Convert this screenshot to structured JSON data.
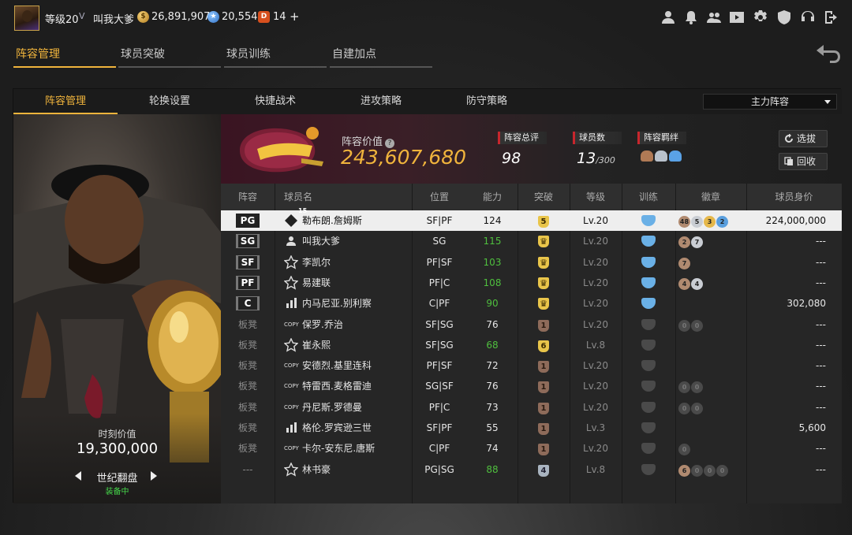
{
  "topbar": {
    "level": "等级20",
    "rank_badge": "V",
    "username": "叫我大爹",
    "gold": "26,891,907",
    "stars": "20,554",
    "tickets": "14",
    "plus": "+"
  },
  "main_tabs": [
    "阵容管理",
    "球员突破",
    "球员训练",
    "自建加点"
  ],
  "sub_tabs": [
    "阵容管理",
    "轮换设置",
    "快捷战术",
    "进攻策略",
    "防守策略"
  ],
  "lineup_select": "主力阵容",
  "card": {
    "value_label": "时刻价值",
    "value": "19,300,000",
    "name": "世纪翻盘",
    "status": "装备中"
  },
  "team": {
    "value_label": "阵容价值",
    "value": "243,607,680",
    "rating_label": "阵容总评",
    "rating": "98",
    "count_label": "球员数",
    "count": "13",
    "count_max": "/300",
    "bond_label": "阵容羁绊",
    "btn_select": "选拔",
    "btn_recycle": "回收"
  },
  "table": {
    "headers": [
      "阵容",
      "球员名",
      "位置",
      "能力",
      "突破",
      "等级",
      "训练",
      "徽章",
      "球员身价"
    ],
    "rows": [
      {
        "slot": "PG",
        "starter": true,
        "type": "15",
        "name": "勒布朗.詹姆斯",
        "pos": "SF|PF",
        "ability": "124",
        "ab_color": "white",
        "break": "5",
        "break_style": "gold",
        "level": "Lv.20",
        "train": "blue",
        "medals": [
          {
            "t": "48",
            "c": "bronze"
          },
          {
            "t": "5",
            "c": "silver"
          },
          {
            "t": "3",
            "c": "gold"
          },
          {
            "t": "2",
            "c": "blue"
          }
        ],
        "value": "224,000,000"
      },
      {
        "slot": "SG",
        "starter": true,
        "type": "person",
        "name": "叫我大爹",
        "pos": "SG",
        "ability": "115",
        "ab_color": "green",
        "break": "crown",
        "break_style": "gold",
        "level": "Lv.20",
        "train": "blue",
        "medals": [
          {
            "t": "2",
            "c": "bronze"
          },
          {
            "t": "7",
            "c": "silver"
          }
        ],
        "value": "---"
      },
      {
        "slot": "SF",
        "starter": true,
        "type": "star",
        "name": "李凯尔",
        "pos": "PF|SF",
        "ability": "103",
        "ab_color": "green",
        "break": "crown",
        "break_style": "gold",
        "level": "Lv.20",
        "train": "blue",
        "medals": [
          {
            "t": "7",
            "c": "bronze"
          }
        ],
        "value": "---"
      },
      {
        "slot": "PF",
        "starter": true,
        "type": "star",
        "name": "易建联",
        "pos": "PF|C",
        "ability": "108",
        "ab_color": "green",
        "break": "crown",
        "break_style": "gold",
        "level": "Lv.20",
        "train": "blue",
        "medals": [
          {
            "t": "4",
            "c": "bronze"
          },
          {
            "t": "4",
            "c": "silver"
          }
        ],
        "value": "---"
      },
      {
        "slot": "C",
        "starter": true,
        "type": "bars",
        "name": "内马尼亚.别利察",
        "pos": "C|PF",
        "ability": "90",
        "ab_color": "green",
        "break": "crown",
        "break_style": "gold",
        "level": "Lv.20",
        "train": "blue",
        "medals": [],
        "value": "302,080"
      },
      {
        "slot": "板凳",
        "starter": false,
        "type": "copy",
        "name": "保罗.乔治",
        "pos": "SF|SG",
        "ability": "76",
        "ab_color": "white",
        "break": "1",
        "break_style": "brown",
        "level": "Lv.20",
        "train": "grey",
        "medals": [
          {
            "t": "0",
            "c": "dark"
          },
          {
            "t": "0",
            "c": "dark"
          }
        ],
        "value": "---"
      },
      {
        "slot": "板凳",
        "starter": false,
        "type": "star",
        "name": "崔永熙",
        "pos": "SF|SG",
        "ability": "68",
        "ab_color": "green",
        "break": "6",
        "break_style": "gold",
        "level": "Lv.8",
        "train": "grey",
        "medals": [],
        "value": "---"
      },
      {
        "slot": "板凳",
        "starter": false,
        "type": "copy",
        "name": "安德烈.基里连科",
        "pos": "PF|SF",
        "ability": "72",
        "ab_color": "white",
        "break": "1",
        "break_style": "brown",
        "level": "Lv.20",
        "train": "grey",
        "medals": [],
        "value": "---"
      },
      {
        "slot": "板凳",
        "starter": false,
        "type": "copy",
        "name": "特雷西.麦格雷迪",
        "pos": "SG|SF",
        "ability": "76",
        "ab_color": "white",
        "break": "1",
        "break_style": "brown",
        "level": "Lv.20",
        "train": "grey",
        "medals": [
          {
            "t": "0",
            "c": "dark"
          },
          {
            "t": "0",
            "c": "dark"
          }
        ],
        "value": "---"
      },
      {
        "slot": "板凳",
        "starter": false,
        "type": "copy",
        "name": "丹尼斯.罗德曼",
        "pos": "PF|C",
        "ability": "73",
        "ab_color": "white",
        "break": "1",
        "break_style": "brown",
        "level": "Lv.20",
        "train": "grey",
        "medals": [
          {
            "t": "0",
            "c": "dark"
          },
          {
            "t": "0",
            "c": "dark"
          }
        ],
        "value": "---"
      },
      {
        "slot": "板凳",
        "starter": false,
        "type": "bars",
        "name": "格伦.罗宾逊三世",
        "pos": "SF|PF",
        "ability": "55",
        "ab_color": "white",
        "break": "1",
        "break_style": "brown",
        "level": "Lv.3",
        "train": "grey",
        "medals": [],
        "value": "5,600"
      },
      {
        "slot": "板凳",
        "starter": false,
        "type": "copy",
        "name": "卡尔-安东尼.唐斯",
        "pos": "C|PF",
        "ability": "74",
        "ab_color": "white",
        "break": "1",
        "break_style": "brown",
        "level": "Lv.20",
        "train": "grey",
        "medals": [
          {
            "t": "0",
            "c": "dark"
          }
        ],
        "value": "---"
      },
      {
        "slot": "---",
        "starter": false,
        "type": "star",
        "name": "林书豪",
        "pos": "PG|SG",
        "ability": "88",
        "ab_color": "green",
        "break": "4",
        "break_style": "grey",
        "level": "Lv.8",
        "train": "grey",
        "medals": [
          {
            "t": "6",
            "c": "bronze"
          },
          {
            "t": "0",
            "c": "dark"
          },
          {
            "t": "0",
            "c": "dark"
          },
          {
            "t": "0",
            "c": "dark"
          }
        ],
        "value": "---"
      }
    ]
  },
  "icons": [
    "profile-icon",
    "bell-icon",
    "friends-icon",
    "video-icon",
    "settings-icon",
    "shield-icon",
    "headset-icon",
    "logout-icon"
  ],
  "colors": {
    "accent": "#f0b43c",
    "green": "#4fbf3e",
    "red": "#c8262d"
  }
}
